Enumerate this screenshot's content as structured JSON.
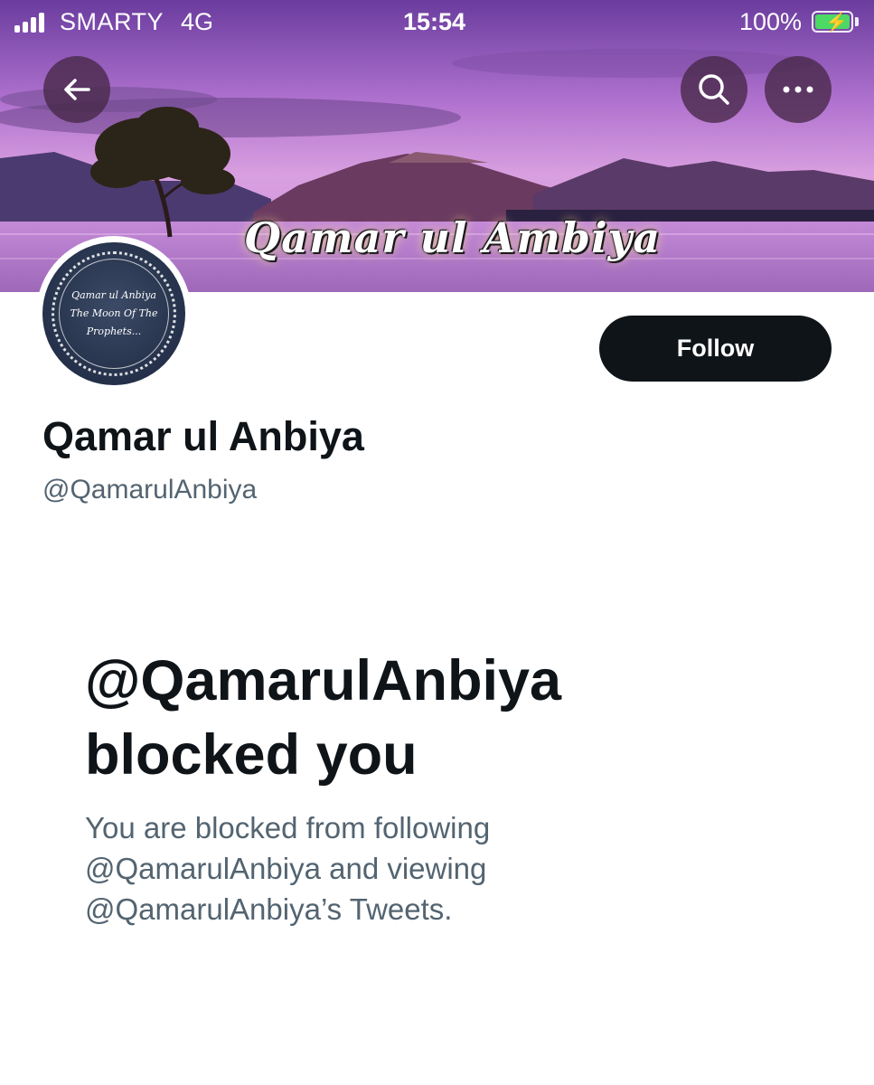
{
  "status_bar": {
    "carrier": "SMARTY",
    "network": "4G",
    "time": "15:54",
    "battery_percent": "100%"
  },
  "banner": {
    "title": "Qamar ul Ambiya"
  },
  "header": {
    "back_icon": "arrow-left-icon",
    "search_icon": "search-icon",
    "more_icon": "more-horizontal-icon"
  },
  "avatar": {
    "line1": "Qamar ul Anbiya",
    "line2": "The Moon Of The",
    "line3": "Prophets..."
  },
  "profile": {
    "follow_label": "Follow",
    "display_name": "Qamar ul Anbiya",
    "handle": "@QamarulAnbiya"
  },
  "blocked": {
    "title_line1": "@QamarulAnbiya",
    "title_line2": "blocked you",
    "desc_line1": "You are blocked from following",
    "desc_line2": "@QamarulAnbiya and viewing",
    "desc_line3": "@QamarulAnbiya’s Tweets."
  },
  "colors": {
    "follow_bg": "#0f1419",
    "secondary_text": "#536471",
    "banner_sky": "#9a62c2"
  }
}
